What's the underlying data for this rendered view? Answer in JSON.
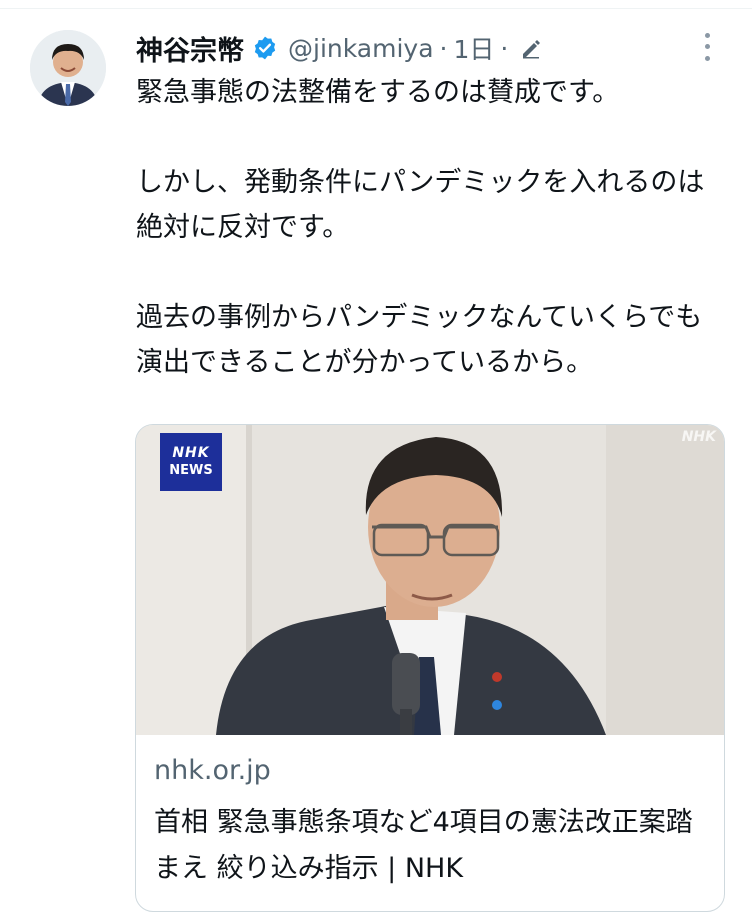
{
  "author": {
    "name": "神谷宗幣",
    "handle": "@jinkamiya",
    "separator": "·",
    "time": "1日",
    "verified_color": "#1d9bf0"
  },
  "tweet": {
    "paragraphs": [
      "緊急事態の法整備をするのは賛成です。",
      "しかし、発動条件にパンデミックを入れるのは絶対に反対です。",
      "過去の事例からパンデミックなんていくらでも演出できることが分かっているから。"
    ]
  },
  "card": {
    "logo_line1": "NHK",
    "logo_line2": "NEWS",
    "watermark": "NHK",
    "domain": "nhk.or.jp",
    "title": "首相 緊急事態条項など4項目の憲法改正案踏まえ 絞り込み指示 | NHK"
  },
  "icons": {
    "verified": "verified-badge-icon",
    "edit": "edit-pencil-icon",
    "more": "more-options-icon"
  },
  "colors": {
    "accent": "#1d9bf0",
    "text": "#0f1419",
    "secondary": "#536471",
    "border": "#cfd9de",
    "nhk_blue": "#1d2f9a"
  }
}
